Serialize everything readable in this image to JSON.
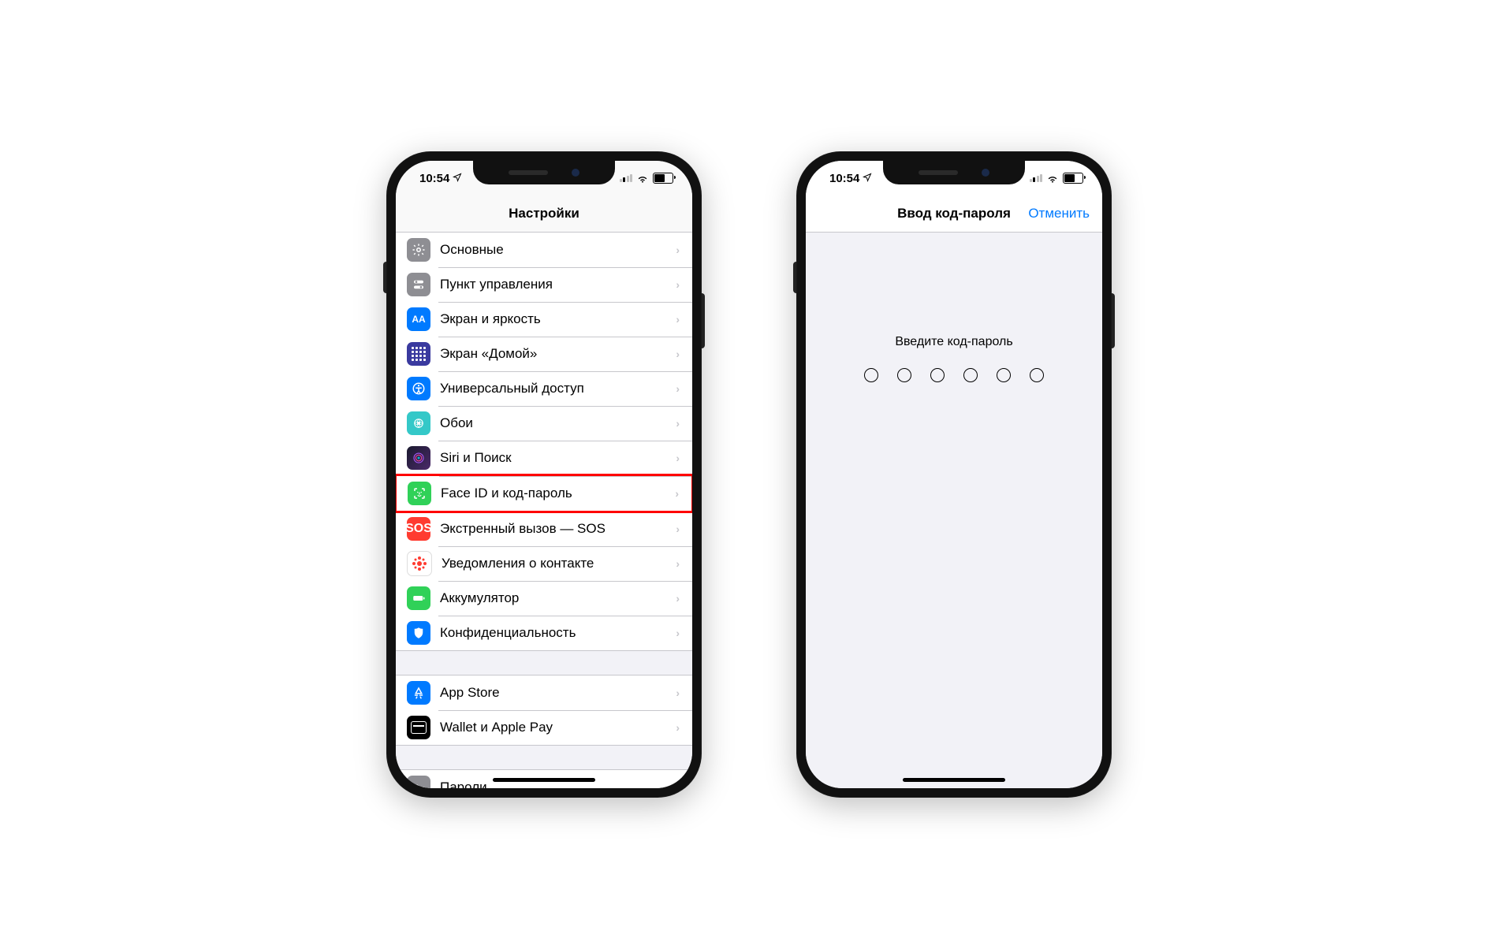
{
  "status": {
    "time": "10:54",
    "location_icon": "↖"
  },
  "phone1": {
    "title": "Настройки",
    "group1": [
      {
        "label": "Основные",
        "icon": "general",
        "color": "ic-general"
      },
      {
        "label": "Пункт управления",
        "icon": "control",
        "color": "ic-control"
      },
      {
        "label": "Экран и яркость",
        "icon": "display",
        "color": "ic-display"
      },
      {
        "label": "Экран «Домой»",
        "icon": "home",
        "color": "ic-home"
      },
      {
        "label": "Универсальный доступ",
        "icon": "access",
        "color": "ic-access"
      },
      {
        "label": "Обои",
        "icon": "wallpaper",
        "color": "ic-wall"
      },
      {
        "label": "Siri и Поиск",
        "icon": "siri",
        "color": "ic-siri"
      },
      {
        "label": "Face ID и код-пароль",
        "icon": "faceid",
        "color": "ic-faceid",
        "highlighted": true
      },
      {
        "label": "Экстренный вызов — SOS",
        "icon": "sos",
        "color": "ic-sos"
      },
      {
        "label": "Уведомления о контакте",
        "icon": "exposure",
        "color": "ic-expose"
      },
      {
        "label": "Аккумулятор",
        "icon": "battery",
        "color": "ic-battery"
      },
      {
        "label": "Конфиденциальность",
        "icon": "privacy",
        "color": "ic-privacy"
      }
    ],
    "group2": [
      {
        "label": "App Store",
        "icon": "appstore",
        "color": "ic-appstore"
      },
      {
        "label": "Wallet и Apple Pay",
        "icon": "wallet",
        "color": "ic-wallet"
      }
    ],
    "group3": [
      {
        "label": "Пароли",
        "icon": "passwords",
        "color": "ic-passwords"
      }
    ]
  },
  "phone2": {
    "title": "Ввод код-пароля",
    "cancel": "Отменить",
    "prompt": "Введите код-пароль",
    "digits": 6
  }
}
